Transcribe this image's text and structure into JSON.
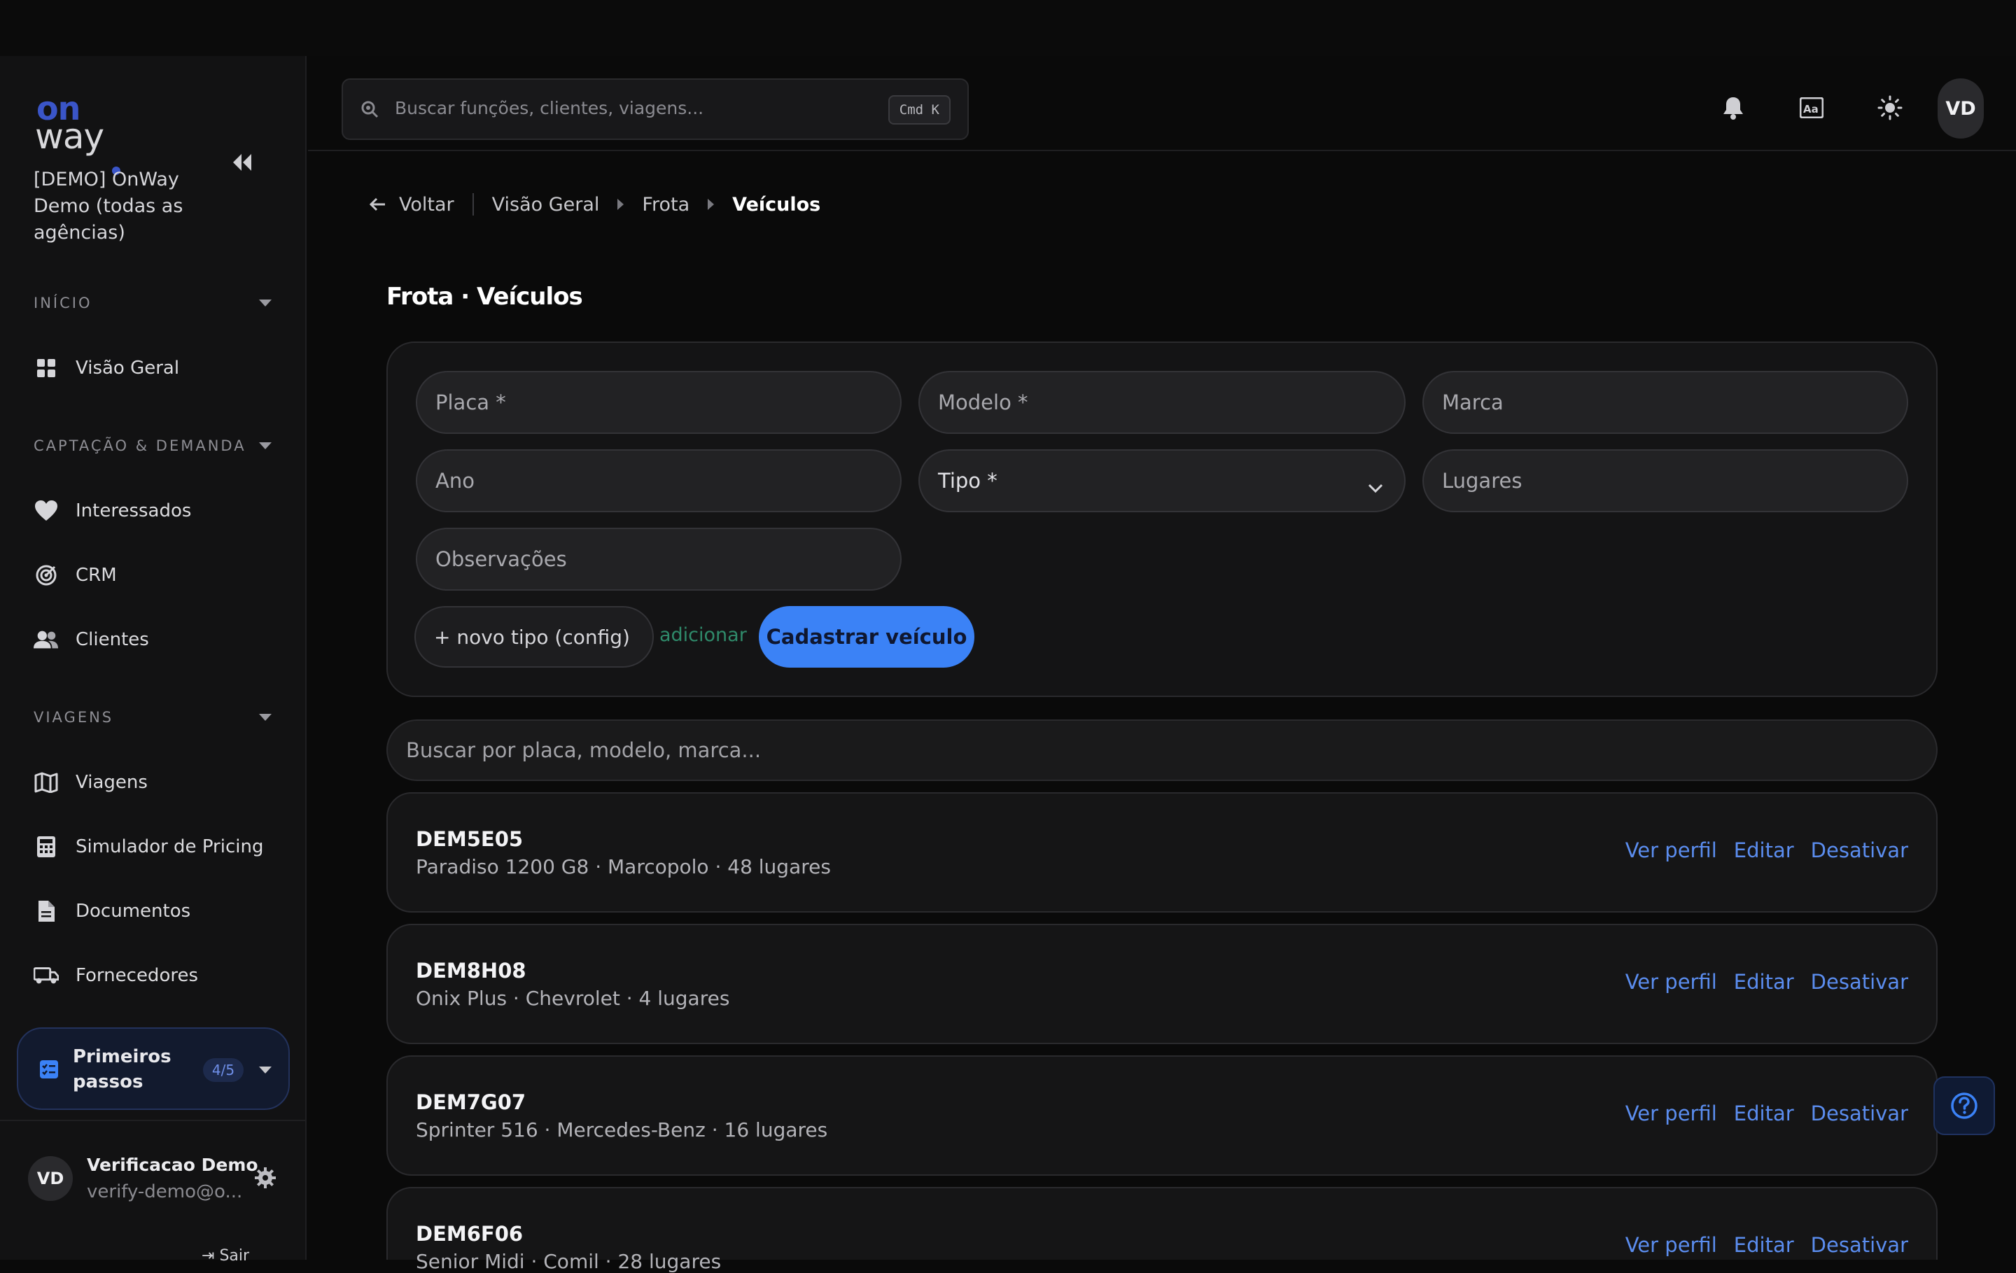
{
  "brand": {
    "logo_top": "on",
    "logo_bottom": "way"
  },
  "sidebar": {
    "org_name": "[DEMO] OnWay Demo (todas as agências)",
    "sections": [
      {
        "label": "INÍCIO",
        "items": [
          {
            "label": "Visão Geral",
            "icon": "grid-icon"
          }
        ]
      },
      {
        "label": "CAPTAÇÃO & DEMANDA",
        "items": [
          {
            "label": "Interessados",
            "icon": "heart-icon"
          },
          {
            "label": "CRM",
            "icon": "target-icon"
          },
          {
            "label": "Clientes",
            "icon": "users-icon"
          }
        ]
      },
      {
        "label": "VIAGENS",
        "items": [
          {
            "label": "Viagens",
            "icon": "map-icon"
          },
          {
            "label": "Simulador de Pricing",
            "icon": "calculator-icon"
          },
          {
            "label": "Documentos",
            "icon": "document-icon"
          },
          {
            "label": "Fornecedores",
            "icon": "truck-icon"
          }
        ]
      }
    ],
    "onboarding": {
      "label": "Primeiros passos",
      "badge": "4/5"
    },
    "user": {
      "initials": "VD",
      "name": "Verificacao Demo",
      "email": "verify-demo@o..."
    },
    "logout_label": "Sair"
  },
  "header": {
    "search_placeholder": "Buscar funções, clientes, viagens...",
    "shortcut": "Cmd K",
    "avatar": "VD"
  },
  "breadcrumb": {
    "back": "Voltar",
    "items": [
      "Visão Geral",
      "Frota",
      "Veículos"
    ]
  },
  "page_title": "Frota · Veículos",
  "form": {
    "placa": "Placa *",
    "modelo": "Modelo *",
    "marca": "Marca",
    "ano": "Ano",
    "tipo": "Tipo *",
    "lugares": "Lugares",
    "observacoes": "Observações",
    "new_type_button": "+ novo tipo (config)",
    "add_link": "adicionar",
    "submit": "Cadastrar veículo"
  },
  "list_search_placeholder": "Buscar por placa, modelo, marca...",
  "vehicles": [
    {
      "plate": "DEM5E05",
      "desc": "Paradiso 1200 G8 · Marcopolo · 48 lugares"
    },
    {
      "plate": "DEM8H08",
      "desc": "Onix Plus · Chevrolet · 4 lugares"
    },
    {
      "plate": "DEM7G07",
      "desc": "Sprinter 516 · Mercedes-Benz · 16 lugares"
    },
    {
      "plate": "DEM6F06",
      "desc": "Senior Midi · Comil · 28 lugares"
    }
  ],
  "row_actions": {
    "view": "Ver perfil",
    "edit": "Editar",
    "deactivate": "Desativar"
  },
  "colors": {
    "accent": "#3b82f6",
    "link": "#5b8def",
    "add_link": "#2f8a6a",
    "background": "#0a0a0a"
  }
}
